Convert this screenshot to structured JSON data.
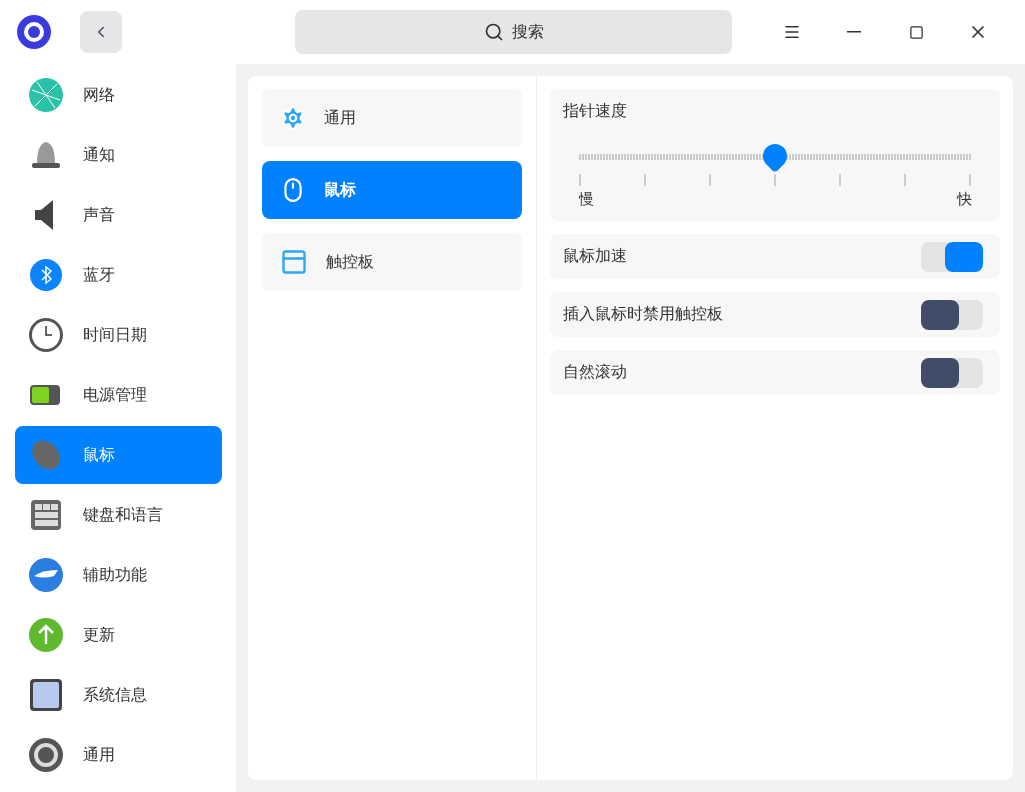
{
  "search": {
    "placeholder": "搜索"
  },
  "sidebar": {
    "items": [
      {
        "label": "网络",
        "selected": false
      },
      {
        "label": "通知",
        "selected": false
      },
      {
        "label": "声音",
        "selected": false
      },
      {
        "label": "蓝牙",
        "selected": false
      },
      {
        "label": "时间日期",
        "selected": false
      },
      {
        "label": "电源管理",
        "selected": false
      },
      {
        "label": "鼠标",
        "selected": true
      },
      {
        "label": "键盘和语言",
        "selected": false
      },
      {
        "label": "辅助功能",
        "selected": false
      },
      {
        "label": "更新",
        "selected": false
      },
      {
        "label": "系统信息",
        "selected": false
      },
      {
        "label": "通用",
        "selected": false
      }
    ]
  },
  "subnav": {
    "items": [
      {
        "label": "通用",
        "selected": false
      },
      {
        "label": "鼠标",
        "selected": true
      },
      {
        "label": "触控板",
        "selected": false
      }
    ]
  },
  "pointer_speed": {
    "title": "指针速度",
    "level": 0.5,
    "min_label": "慢",
    "max_label": "快"
  },
  "toggles": [
    {
      "label": "鼠标加速",
      "on": true
    },
    {
      "label": "插入鼠标时禁用触控板",
      "on": false
    },
    {
      "label": "自然滚动",
      "on": false
    }
  ]
}
